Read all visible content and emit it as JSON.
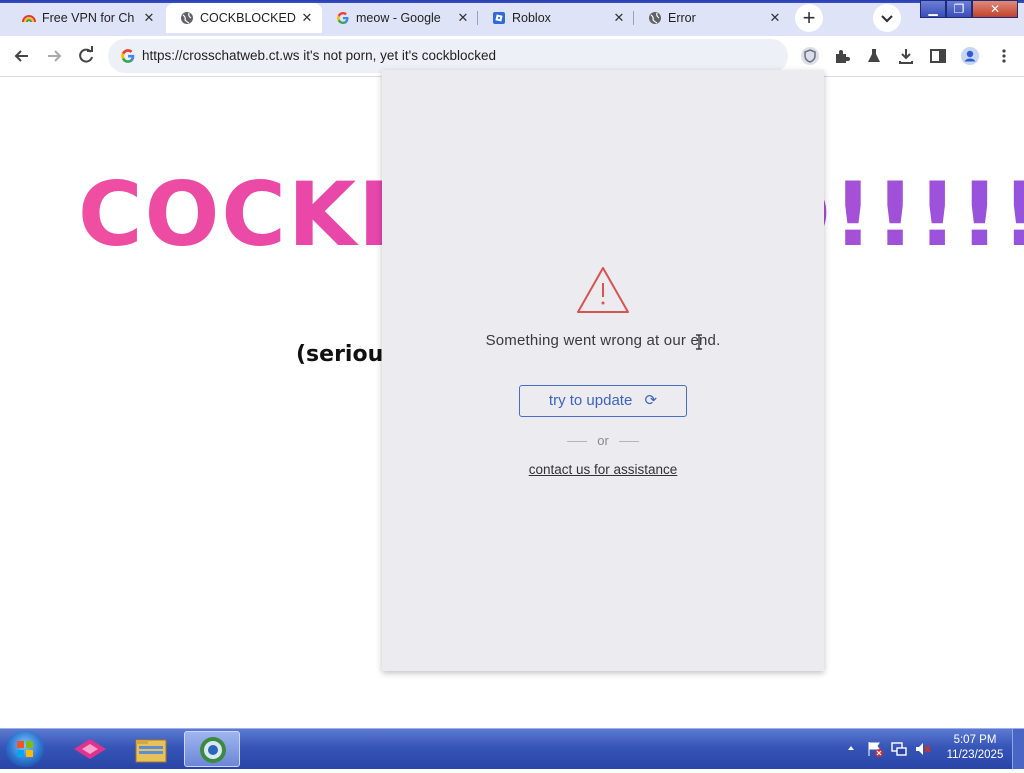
{
  "tabs": [
    {
      "title": "Free VPN for Ch",
      "icon": "rainbow-vpn-icon",
      "active": false
    },
    {
      "title": "COCKBLOCKED",
      "icon": "globe-icon",
      "active": true
    },
    {
      "title": "meow - Google",
      "icon": "google-icon",
      "active": false
    },
    {
      "title": "Roblox",
      "icon": "roblox-icon",
      "active": false
    },
    {
      "title": "Error",
      "icon": "globe-icon",
      "active": false
    }
  ],
  "toolbar": {
    "url": "https://crosschatweb.ct.ws it's not porn, yet it's cockblocked"
  },
  "page": {
    "headline": "COCKBLOCKED!!!!!!",
    "subline": "(seriously)"
  },
  "popup": {
    "message": "Something went wrong at our end.",
    "button_label": "try to update",
    "or_text": "or",
    "contact_link": "contact us for assistance"
  },
  "taskbar": {
    "time": "5:07 PM",
    "date": "11/23/2025"
  },
  "colors": {
    "accent_blue": "#3c63c0",
    "warning_red": "#d9534f",
    "headline_pink": "#f04ea0",
    "headline_purple": "#8f55e0",
    "popup_bg": "#ebebf0"
  }
}
